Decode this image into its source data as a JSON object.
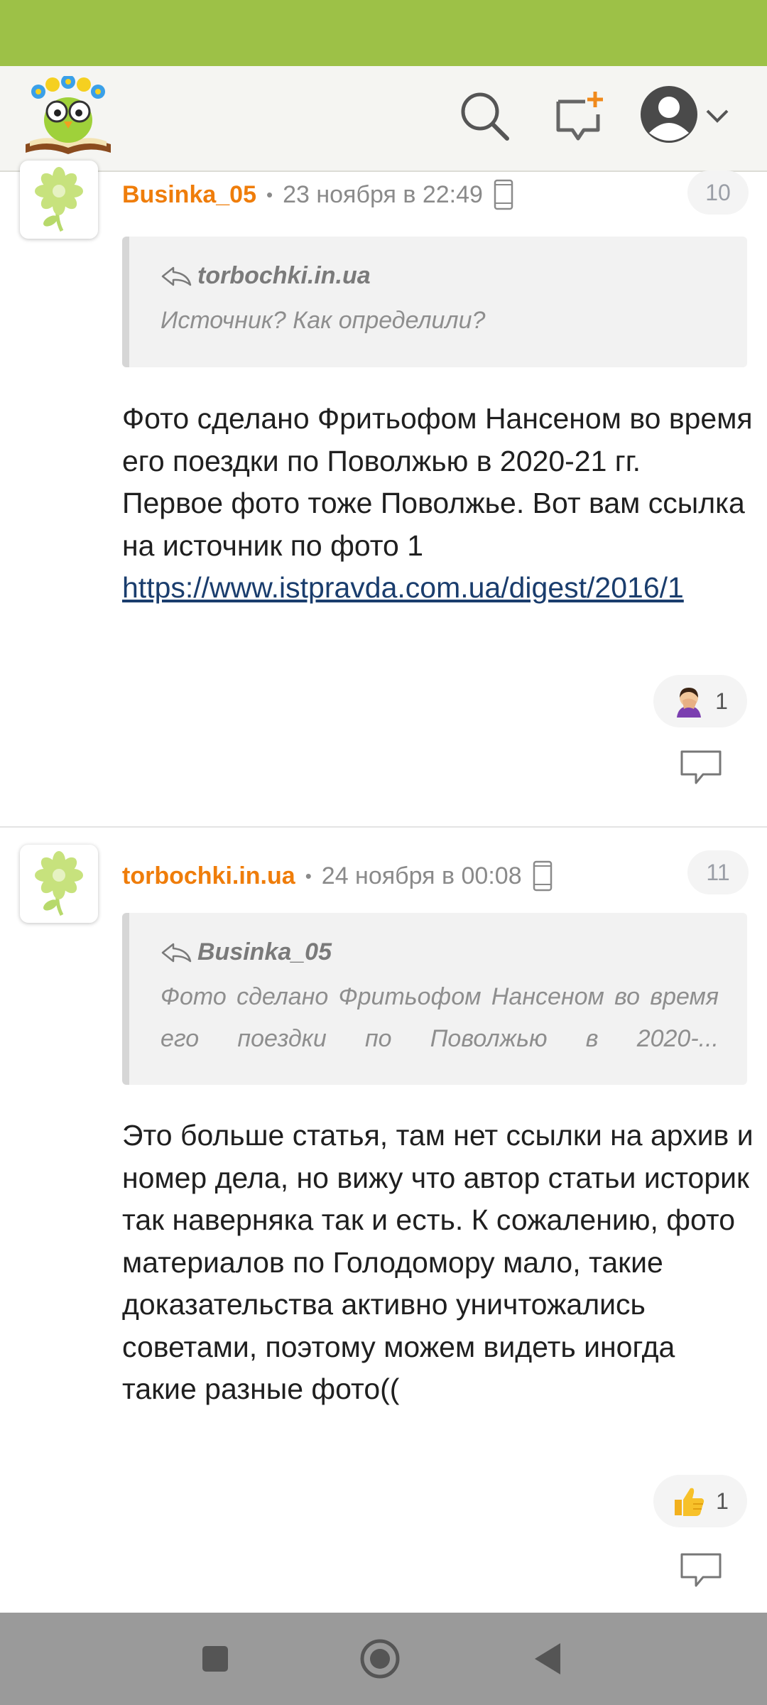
{
  "header": {
    "logo_icon": "owl-on-book-logo",
    "search_icon": "search-icon",
    "new_message_icon": "new-message-icon",
    "avatar_icon": "user-avatar-icon",
    "chevron_icon": "chevron-down-icon"
  },
  "comments": [
    {
      "author": "Businka_05",
      "date": "23 ноября в 22:49",
      "number": "10",
      "quote_author": "torbochki.in.ua",
      "quote_text": "Источник? Как определили?",
      "body_lines": [
        "Фото сделано Фритьофом Нансеном во время его поездки по Поволжью в 2020-21 гг.",
        "Первое фото тоже Поволжье. Вот вам ссылка на источник по фото 1"
      ],
      "link": "https://www.istpravda.com.ua/digest/2016/1",
      "reaction_icon": "facepalm-emoji",
      "reaction_count": "1"
    },
    {
      "author": "torbochki.in.ua",
      "date": "24 ноября в 00:08",
      "number": "11",
      "quote_author": "Businka_05",
      "quote_text": "Фото сделано Фритьофом Нансеном во время его поездки по Поволжью в 2020-...",
      "body": "Это больше статья, там нет ссылки на архив и номер дела, но вижу что автор статьи историк так наверняка так и есть. К сожалению, фото материалов по Голодомору мало, такие доказательства активно уничтожались советами, поэтому можем видеть иногда такие разные фото((",
      "reaction_icon": "thumbs-up-emoji",
      "reaction_count": "1"
    }
  ],
  "colors": {
    "status_bar": "#9dc147",
    "author": "#ef7d0a",
    "link": "#1a3d6d",
    "nav_bar": "#9a9a9a"
  }
}
